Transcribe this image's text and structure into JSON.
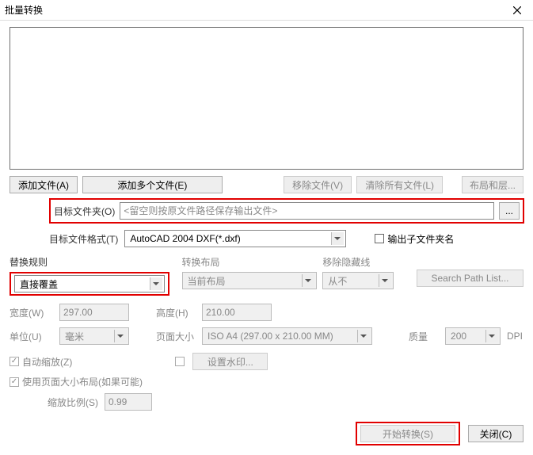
{
  "title": "批量转换",
  "buttons": {
    "add_file": "添加文件(A)",
    "add_files": "添加多个文件(E)",
    "remove_file": "移除文件(V)",
    "clear_all": "清除所有文件(L)",
    "layout": "布局和层...",
    "browse": "...",
    "watermark_btn": "设置水印...",
    "search_path": "Search Path List...",
    "start": "开始转换(S)",
    "close": "关闭(C)"
  },
  "labels": {
    "target_folder": "目标文件夹(O)",
    "target_fmt": "目标文件格式(T)",
    "output_subname": "输出子文件夹名",
    "replace_rule": "替换规则",
    "convert_layout": "转换布局",
    "remove_hidden": "移除隐藏线",
    "width": "宽度(W)",
    "height": "高度(H)",
    "unit": "单位(U)",
    "page_size": "页面大小",
    "quality": "质量",
    "dpi": "DPI",
    "auto_scale": "自动缩放(Z)",
    "use_paper_layout": "使用页面大小布局(如果可能)",
    "scale_pct": "缩放比例(S)"
  },
  "fields": {
    "target_folder_ph": "<留空则按原文件路径保存输出文件>",
    "format_value": "AutoCAD 2004 DXF(*.dxf)",
    "replace_value": "直接覆盖",
    "layout_value": "当前布局",
    "hidden_value": "从不",
    "width_value": "297.00",
    "height_value": "210.00",
    "unit_value": "毫米",
    "pagesize_value": "ISO A4 (297.00 x 210.00 MM)",
    "quality_value": "200",
    "scale_value": "0.99"
  },
  "checkmark": "✓"
}
